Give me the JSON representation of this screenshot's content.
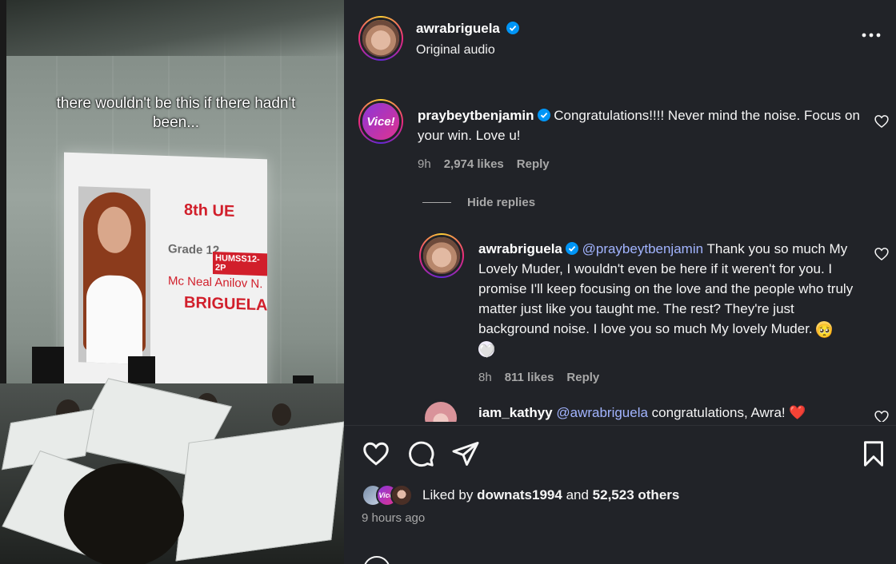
{
  "media": {
    "caption": "there wouldn't be this if there hadn't been...",
    "screen": {
      "heading": "8th UE",
      "grade": "Grade 12",
      "section": "HUMSS12-2P",
      "name_line1": "Mc Neal Anilov N.",
      "name_line2": "BRIGUELA"
    }
  },
  "post": {
    "author": "awrabriguela",
    "audio": "Original audio",
    "more_icon": "more-horizontal-icon"
  },
  "comments": [
    {
      "username": "praybeytbenjamin",
      "verified": true,
      "avatar_text": "Vice!",
      "text": "Congratulations!!!! Never mind the noise. Focus on your win. Love u!",
      "time": "9h",
      "likes": "2,974 likes",
      "reply_label": "Reply"
    }
  ],
  "hide_replies_label": "Hide replies",
  "replies": [
    {
      "username": "awrabriguela",
      "verified": true,
      "mention": "@praybeytbenjamin",
      "text": " Thank you so much My Lovely Muder, I wouldn't even be here if it weren't for you. I promise I'll keep focusing on the love and the people who truly matter just like you taught me. The rest? They're just background noise. I love you so much My lovely Muder. ",
      "emojis": [
        "🥺",
        "🤍"
      ],
      "time": "8h",
      "likes": "811 likes",
      "reply_label": "Reply"
    },
    {
      "username": "iam_kathyy",
      "mention": "@awrabriguela",
      "text": " congratulations, Awra! ",
      "emoji": "❤️"
    }
  ],
  "actions": {
    "like_icon": "heart-icon",
    "comment_icon": "comment-icon",
    "share_icon": "send-icon",
    "save_icon": "bookmark-icon"
  },
  "likes_summary": {
    "prefix": "Liked by",
    "user": "downats1994",
    "and": "and",
    "others": "52,523 others"
  },
  "time_ago": "9 hours ago",
  "colors": {
    "panel_bg": "#212328",
    "mention": "#a2b4ff",
    "verified": "#0095f6",
    "muted": "#a8a8a8"
  }
}
